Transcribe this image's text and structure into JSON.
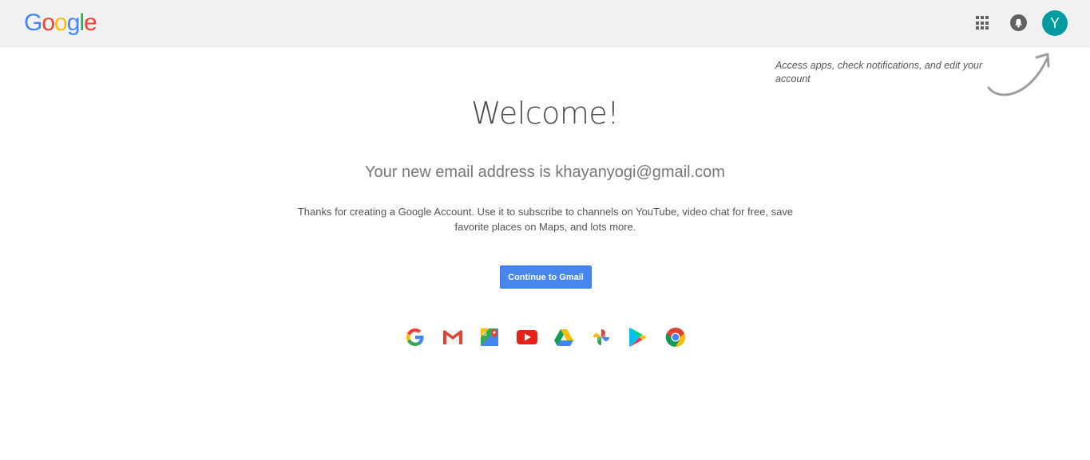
{
  "header": {
    "logo_letters": [
      {
        "char": "G",
        "color": "#4285f4"
      },
      {
        "char": "o",
        "color": "#ea4335"
      },
      {
        "char": "o",
        "color": "#fbbc05"
      },
      {
        "char": "g",
        "color": "#4285f4"
      },
      {
        "char": "l",
        "color": "#34a853"
      },
      {
        "char": "e",
        "color": "#ea4335"
      }
    ],
    "apps_icon": "apps-grid-icon",
    "notifications_icon": "bell-icon",
    "avatar_initial": "Y",
    "avatar_color": "#009b9e"
  },
  "hint": {
    "text": "Access apps, check notifications, and edit your account"
  },
  "main": {
    "title": "Welcome!",
    "email_line": "Your new email address is khayanyogi@gmail.com",
    "description": "Thanks for creating a Google Account. Use it to subscribe to channels on YouTube, video chat for free, save favorite places on Maps, and lots more.",
    "cta_label": "Continue to Gmail"
  },
  "products": [
    {
      "name": "google-search-icon"
    },
    {
      "name": "gmail-icon"
    },
    {
      "name": "maps-icon"
    },
    {
      "name": "youtube-icon"
    },
    {
      "name": "drive-icon"
    },
    {
      "name": "photos-icon"
    },
    {
      "name": "play-store-icon"
    },
    {
      "name": "chrome-icon"
    }
  ],
  "colors": {
    "header_bg": "#f1f1f1",
    "button_blue": "#4787ed"
  }
}
